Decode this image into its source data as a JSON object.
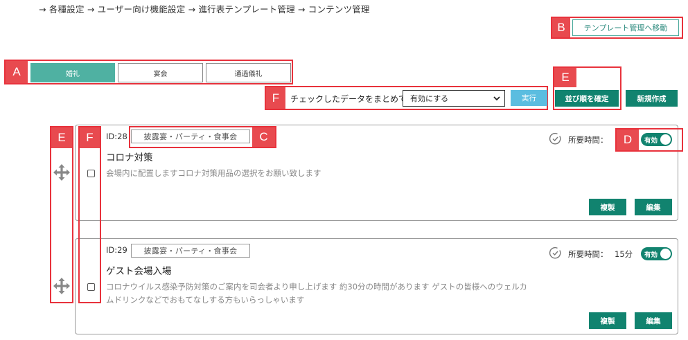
{
  "breadcrumb": "→ 各種設定 → ユーザー向け機能設定 → 進行表テンプレート管理 → コンテンツ管理",
  "header": {
    "move_to_template_label": "テンプレート管理へ移動"
  },
  "tabs": [
    {
      "label": "婚礼",
      "active": true
    },
    {
      "label": "宴会",
      "active": false
    },
    {
      "label": "通過儀礼",
      "active": false
    }
  ],
  "bulk_action": {
    "label": "チェックしたデータをまとめて",
    "selected": "有効にする",
    "execute_label": "実行"
  },
  "toolbar": {
    "confirm_order_label": "並び順を確定",
    "new_label": "新規作成"
  },
  "annotations": {
    "A": "A",
    "B": "B",
    "C": "C",
    "D": "D",
    "E1": "E",
    "E2": "E",
    "F1": "F",
    "F2": "F"
  },
  "items": [
    {
      "id_text": "ID:28",
      "category": "披露宴・パーティ・食事会",
      "title": "コロナ対策",
      "description_lines": [
        "会場内に配置しますコロナ対策用品の選択をお願い致します"
      ],
      "time_label": "所要時間：",
      "time_value": "",
      "status_label": "有効",
      "enabled": true,
      "copy_label": "複製",
      "edit_label": "編集"
    },
    {
      "id_text": "ID:29",
      "category": "披露宴・パーティ・食事会",
      "title": "ゲスト会場入場",
      "description_lines": [
        "コロナウイルス感染予防対策のご案内を司会者より申し上げます 約30分の時間があります ゲストの皆様へのウェルカ",
        "ムドリンクなどでおもてなしする方もいらっしゃいます"
      ],
      "time_label": "所要時間：",
      "time_value": "15分",
      "status_label": "有効",
      "enabled": true,
      "copy_label": "複製",
      "edit_label": "編集"
    }
  ],
  "colors": {
    "brand_green": "#11836f",
    "tab_active": "#4fb1a2",
    "execute_blue": "#5bbde0",
    "annotation_red": "#e84a4f"
  }
}
